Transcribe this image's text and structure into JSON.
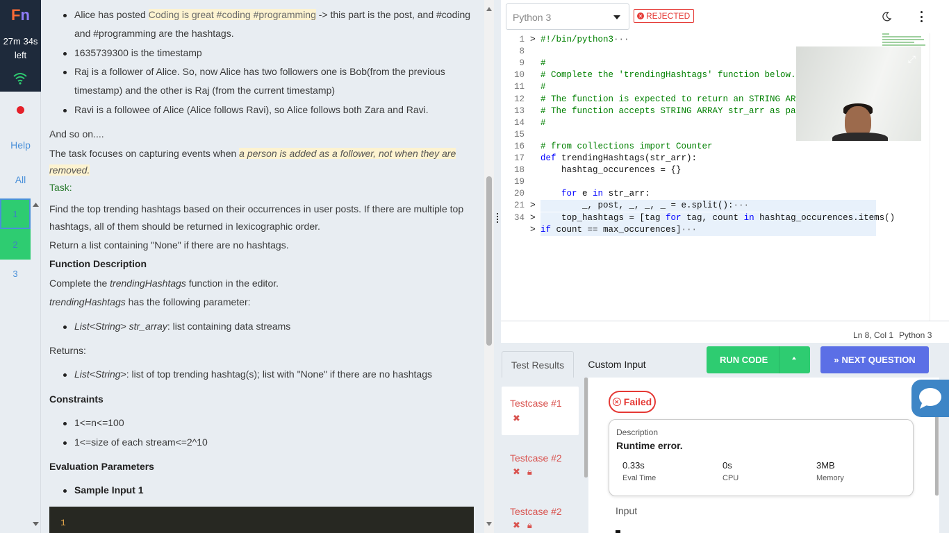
{
  "rail": {
    "logo_f": "F",
    "logo_n": "n",
    "timer_line1": "27m 34s",
    "timer_line2": "left",
    "help": "Help",
    "all": "All",
    "questions": [
      "1",
      "2",
      "3"
    ]
  },
  "problem": {
    "lines": {
      "b1_pre": "Alice has posted ",
      "b1_hl": "Coding is great #coding #programming",
      "b1_post": " -> this part is the post, and #coding",
      "b1_cont": "and #programming are the hashtags.",
      "b2": "1635739300 is the timestamp",
      "b3": "Raj is a follower of Alice. So, now Alice has two followers one is Bob(from the previous",
      "b3_cont": "timestamp) and the other is Raj (from the current timestamp)",
      "b4": "Ravi is a followee of Alice (Alice follows Ravi), so Alice follows both Zara and Ravi.",
      "and_so_on": "And so on....",
      "focus_pre": "The task focuses on capturing events when ",
      "focus_hl": "a person is added as a follower, not when they are",
      "focus_hl2": "removed.",
      "task": "Task:",
      "task1": "Find the top trending hashtags based on their occurrences in user posts. If there are multiple top",
      "task2": "hashtags, all of them should be returned in lexicographic order.",
      "task3": "Return a list containing \"None\" if there are no hashtags.",
      "fd_head": "Function Description",
      "fd1_pre": "Complete the ",
      "fd1_it": "trendingHashtags",
      "fd1_post": " function in the editor.",
      "fd2_it": "trendingHashtags",
      "fd2_post": " has the following parameter:",
      "param_it": "List<String> str_array",
      "param_post": ": list containing data streams",
      "returns": "Returns:",
      "ret_it": "List<String>",
      "ret_post": ": list of top trending hashtag(s); list with \"None\" if there are no hashtags",
      "constraints": "Constraints",
      "c1": "1<=n<=100",
      "c2": "1<=size of each stream<=2^10",
      "eval": "Evaluation Parameters",
      "sample": "Sample Input 1"
    },
    "code_line_no": "1"
  },
  "editor": {
    "language": "Python 3",
    "status": "REJECTED",
    "lines": [
      {
        "n": "1",
        "fold": ">",
        "html": "#!/bin/python3",
        "dots": "···",
        "cls": "cl"
      },
      {
        "n": "8",
        "fold": "",
        "html": "",
        "dots": ""
      },
      {
        "n": "9",
        "fold": "",
        "html": "#",
        "cm": true
      },
      {
        "n": "10",
        "fold": "",
        "html": "# Complete the 'trendingHashtags' function below.",
        "cm": true
      },
      {
        "n": "11",
        "fold": "",
        "html": "#",
        "cm": true
      },
      {
        "n": "12",
        "fold": "",
        "html": "# The function is expected to return an STRING ARRAY.",
        "cm": true
      },
      {
        "n": "13",
        "fold": "",
        "html": "# The function accepts STRING ARRAY str_arr as parameter.",
        "cm": true
      },
      {
        "n": "14",
        "fold": "",
        "html": "#",
        "cm": true
      },
      {
        "n": "15",
        "fold": "",
        "html": ""
      },
      {
        "n": "16",
        "fold": "",
        "html": "# from collections import Counter",
        "cm": true
      },
      {
        "n": "17",
        "fold": "",
        "html": "def trendingHashtags(str_arr):"
      },
      {
        "n": "18",
        "fold": "",
        "html": "    hashtag_occurences = {}"
      },
      {
        "n": "19",
        "fold": "",
        "html": ""
      },
      {
        "n": "20",
        "fold": "",
        "html": "    for e in str_arr:"
      },
      {
        "n": "21",
        "fold": ">",
        "html": "        _, post, _, _, _ = e.split():",
        "dots": "···"
      },
      {
        "n": "34",
        "fold": ">",
        "html": "    top_hashtags = [tag for tag, count in hashtag_occurences.items()",
        "dots": ""
      },
      {
        "n": "",
        "fold": ">",
        "html": "if count == max_occurences]",
        "dots": "···"
      }
    ],
    "status_pos": "Ln 8, Col 1",
    "status_lang": "Python 3"
  },
  "bottom": {
    "tab_results": "Test Results",
    "tab_custom": "Custom Input",
    "run_code": "RUN CODE",
    "next_question": "NEXT QUESTION",
    "testcases": [
      "Testcase #1",
      "Testcase #2",
      "Testcase #2"
    ],
    "result_status": "Failed",
    "desc_label": "Description",
    "desc_value": "Runtime error.",
    "metrics": [
      {
        "value": "0.33s",
        "label": "Eval Time"
      },
      {
        "value": "0s",
        "label": "CPU"
      },
      {
        "value": "3MB",
        "label": "Memory"
      }
    ],
    "input_label": "Input"
  },
  "colors": {
    "run": "#2ecc71",
    "next": "#5b6fe6",
    "rejected": "#e53935"
  }
}
